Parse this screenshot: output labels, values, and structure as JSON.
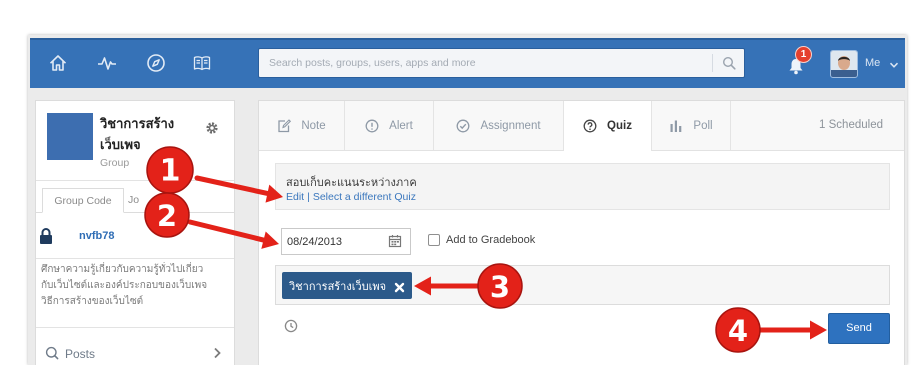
{
  "nav": {
    "search_placeholder": "Search posts, groups, users, apps and more",
    "notification_count": "1",
    "user_label": "Me",
    "icons": [
      "home-icon",
      "activity-icon",
      "compass-icon",
      "book-icon",
      "search-icon",
      "bell-icon",
      "chevron-down-icon"
    ]
  },
  "sidebar": {
    "group": {
      "name_lines": [
        "วิชาการสร้าง",
        "เว็บเพจ"
      ],
      "type": "Group"
    },
    "tabs": [
      {
        "label": "Group Code",
        "active": true
      },
      {
        "label": "Jo",
        "active": false
      }
    ],
    "group_code": "nvfb78",
    "description_lines": [
      "ศึกษาความรู้เกี่ยวกับความรู้ทั่วไปเกี่ยว",
      "กับเว็บไซต์และองค์ประกอบของเว็บเพจ",
      "วิธีการสร้างของเว็บไซต์"
    ],
    "menu": [
      {
        "label": "Posts",
        "icon": "posts-icon"
      }
    ]
  },
  "composer": {
    "tabs": [
      {
        "label": "Note",
        "icon": "note-icon",
        "active": false
      },
      {
        "label": "Alert",
        "icon": "alert-icon",
        "active": false
      },
      {
        "label": "Assignment",
        "icon": "assignment-icon",
        "active": false
      },
      {
        "label": "Quiz",
        "icon": "quiz-icon",
        "active": true
      },
      {
        "label": "Poll",
        "icon": "poll-icon",
        "active": false
      }
    ],
    "scheduled": "1 Scheduled",
    "quiz": {
      "title": "สอบเก็บคะแนนระหว่างภาค",
      "edit_link": "Edit",
      "separator": "|",
      "select_link": "Select a different Quiz"
    },
    "due_date": "08/24/2013",
    "add_to_gradebook": {
      "label": "Add to Gradebook",
      "checked": false
    },
    "recipients": [
      {
        "name": "วิชาการสร้างเว็บเพจ"
      }
    ],
    "send_label": "Send"
  },
  "annotations": [
    {
      "number": "1"
    },
    {
      "number": "2"
    },
    {
      "number": "3"
    },
    {
      "number": "4"
    }
  ],
  "colors": {
    "nav_bg": "#3672b7",
    "annotation_red": "#e32219",
    "recipient_chip": "#2c5a8a",
    "send_button": "#2e72bf",
    "link": "#3b77bd",
    "group_avatar": "#3d6eb0"
  }
}
